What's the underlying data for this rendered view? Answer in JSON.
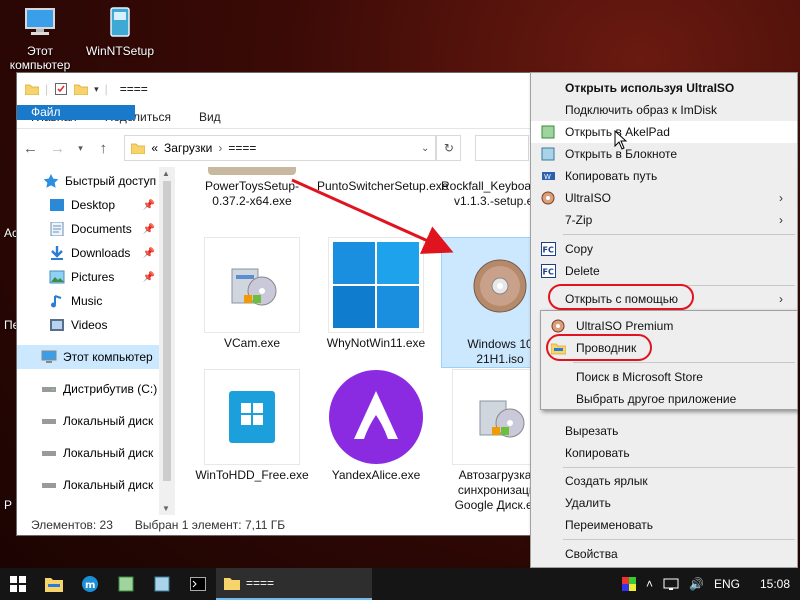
{
  "desktop": {
    "icons": [
      {
        "label": "Этот компьютер",
        "icon": "computer-icon"
      },
      {
        "label": "WinNTSetup",
        "icon": "winntsetup-icon"
      }
    ],
    "edge_labels": [
      "Ас",
      "Пе",
      "Р"
    ]
  },
  "explorer": {
    "title": "====",
    "ribbon_tabs": [
      "Файл",
      "Главная",
      "Поделиться",
      "Вид"
    ],
    "address": {
      "prefix": "«",
      "crumbs": [
        "Загрузки",
        "===="
      ]
    },
    "nav_items": [
      {
        "label": "Быстрый доступ",
        "icon": "star-icon",
        "pinned": false
      },
      {
        "label": "Desktop",
        "icon": "desktop-folder-icon",
        "pinned": true
      },
      {
        "label": "Documents",
        "icon": "documents-icon",
        "pinned": true
      },
      {
        "label": "Downloads",
        "icon": "downloads-icon",
        "pinned": true
      },
      {
        "label": "Pictures",
        "icon": "pictures-icon",
        "pinned": true
      },
      {
        "label": "Music",
        "icon": "music-icon",
        "pinned": false
      },
      {
        "label": "Videos",
        "icon": "videos-icon",
        "pinned": false
      },
      {
        "label": "Этот компьютер",
        "icon": "computer-icon",
        "pinned": false
      },
      {
        "label": "Дистрибутив (C:)",
        "icon": "drive-icon",
        "pinned": false
      },
      {
        "label": "Локальный диск",
        "icon": "drive-icon",
        "pinned": false
      },
      {
        "label": "Локальный диск",
        "icon": "drive-icon",
        "pinned": false
      },
      {
        "label": "Локальный диск",
        "icon": "drive-icon",
        "pinned": false
      }
    ],
    "files": [
      {
        "name": "PowerToysSetup-0.37.2-x64.exe",
        "icon": "installer-icon"
      },
      {
        "name": "PuntoSwitcherSetup.exe",
        "icon": "installer-icon"
      },
      {
        "name": "Rockfall_Keyboard_Engine-v1.1.3.-setup.exe",
        "icon": "installer-icon"
      },
      {
        "name": "VCam.exe",
        "icon": "installer-icon"
      },
      {
        "name": "WhyNotWin11.exe",
        "icon": "windows11-icon"
      },
      {
        "name": "Windows 10 21H1.iso",
        "icon": "disc-icon"
      },
      {
        "name": "WinToHDD_Free.exe",
        "icon": "wintohdd-icon"
      },
      {
        "name": "YandexAlice.exe",
        "icon": "alice-icon"
      },
      {
        "name": "Автозагрузка и синхронизация Google Диск.exe",
        "icon": "installer-icon"
      }
    ],
    "status": {
      "count": "Элементов: 23",
      "selected": "Выбран 1 элемент: 7,11 ГБ"
    }
  },
  "context_menu": {
    "items": [
      {
        "label": "Открыть используя UltraISO",
        "bold": true
      },
      {
        "label": "Подключить образ к ImDisk"
      },
      {
        "label": "Открыть в AkelPad",
        "icon": "akelpad-icon"
      },
      {
        "label": "Открыть в Блокноте",
        "icon": "notepad-icon"
      },
      {
        "label": "Копировать путь",
        "icon": "copy-path-icon"
      },
      {
        "label": "UltraISO",
        "icon": "ultraiso-icon",
        "submenu": true
      },
      {
        "label": "7-Zip",
        "submenu": true
      },
      {
        "label": "Copy",
        "icon": "fc-icon"
      },
      {
        "label": "Delete",
        "icon": "fc-icon"
      },
      {
        "label": "Открыть с помощью",
        "submenu": true
      },
      {
        "label": "Вырезать"
      },
      {
        "label": "Копировать"
      },
      {
        "label": "Создать ярлык"
      },
      {
        "label": "Удалить"
      },
      {
        "label": "Переименовать"
      },
      {
        "label": "Свойства"
      }
    ]
  },
  "submenu": {
    "items": [
      {
        "label": "UltraISO Premium",
        "icon": "ultraiso-icon"
      },
      {
        "label": "Проводник",
        "icon": "explorer-icon"
      },
      {
        "label": "Поиск в Microsoft Store"
      },
      {
        "label": "Выбрать другое приложение"
      }
    ]
  },
  "taskbar": {
    "active_window": "====",
    "language": "ENG",
    "time": "15:08"
  },
  "colors": {
    "accent": "#1979ca",
    "selection": "#cce8ff",
    "annotation_red": "#e0141e"
  }
}
